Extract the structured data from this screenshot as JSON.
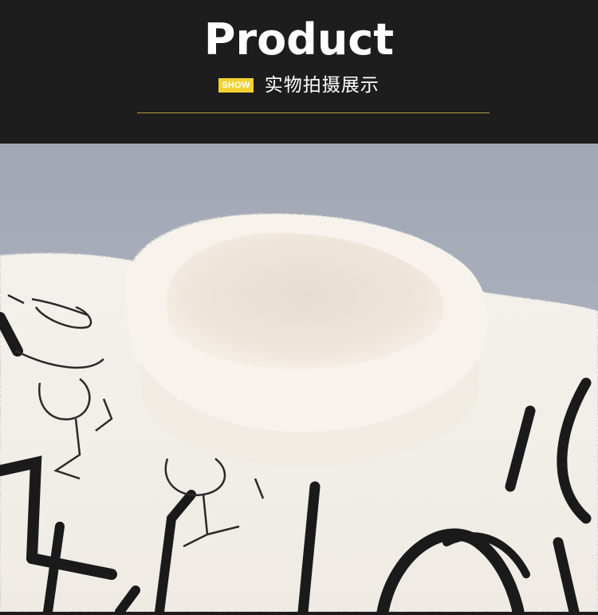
{
  "header": {
    "title": "Product",
    "badge": "SHOW",
    "subtitle": "实物拍摄展示"
  },
  "photo": {
    "subject": "sweater-collar-photo"
  },
  "colors": {
    "header_bg": "#1d1d1d",
    "badge_bg": "#f3d233",
    "divider": "#b59a3a",
    "backdrop": "#a3a9b6",
    "sweater": "#f1ede6"
  }
}
